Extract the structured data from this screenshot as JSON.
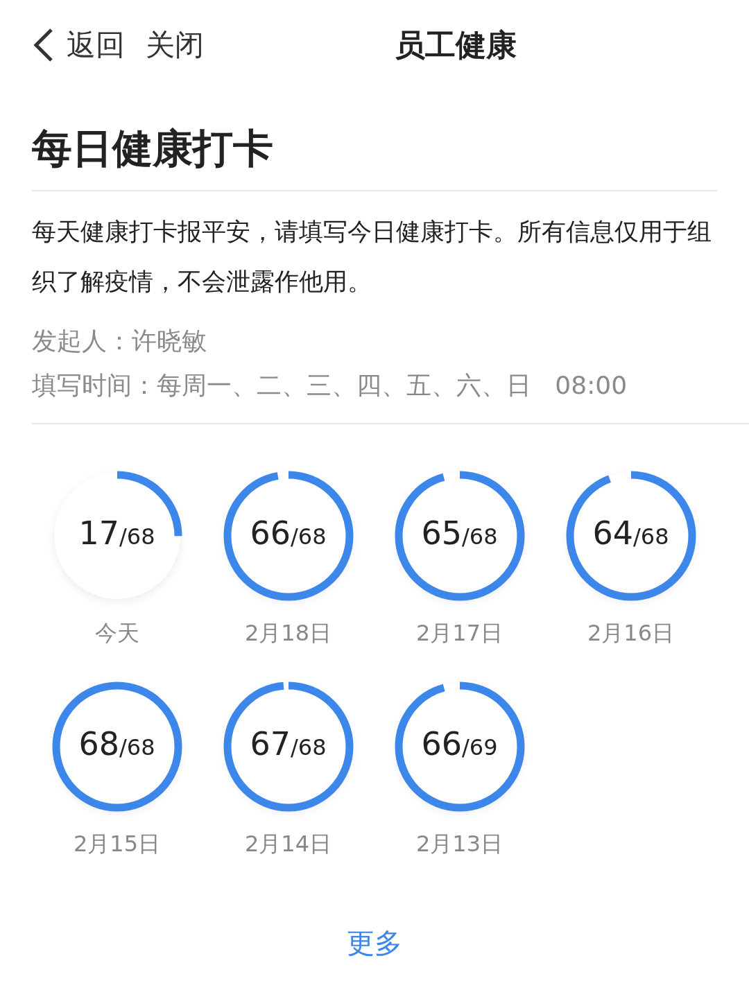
{
  "nav": {
    "back": "返回",
    "close": "关闭",
    "title": "员工健康"
  },
  "heading": "每日健康打卡",
  "description": "每天健康打卡报平安，请填写今日健康打卡。所有信息仅用于组织了解疫情，不会泄露作他用。",
  "meta": [
    "发起人：许晓敏",
    "填写时间：每周一、二、三、四、五、六、日   08:00"
  ],
  "days": [
    {
      "count": "17",
      "total": "/68",
      "level": 0.25,
      "label": "今天"
    },
    {
      "count": "66",
      "total": "/68",
      "level": 0.9706,
      "label": "2月18日"
    },
    {
      "count": "65",
      "total": "/68",
      "level": 0.9559,
      "label": "2月17日"
    },
    {
      "count": "64",
      "total": "/68",
      "level": 0.9412,
      "label": "2月16日"
    },
    {
      "count": "68",
      "total": "/68",
      "level": 1,
      "label": "2月15日"
    },
    {
      "count": "67",
      "total": "/68",
      "level": 0.9853,
      "label": "2月14日"
    },
    {
      "count": "66",
      "total": "/69",
      "level": 0.9565,
      "label": "2月13日"
    }
  ],
  "more": "更多"
}
